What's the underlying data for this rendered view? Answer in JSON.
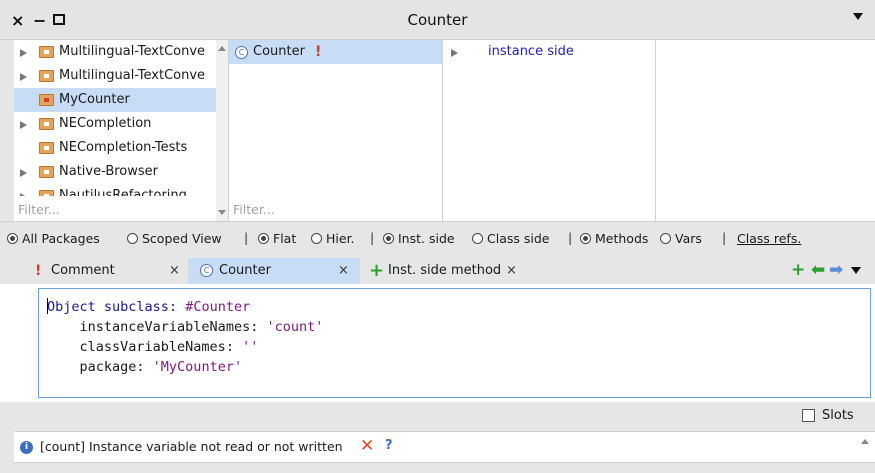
{
  "window": {
    "title": "Counter",
    "close_glyph": "×",
    "min_glyph": "−"
  },
  "packages": {
    "items": [
      {
        "label": "Multilingual-TextConve",
        "expandable": true,
        "selected": false
      },
      {
        "label": "Multilingual-TextConve",
        "expandable": true,
        "selected": false
      },
      {
        "label": "MyCounter",
        "expandable": false,
        "selected": true
      },
      {
        "label": "NECompletion",
        "expandable": true,
        "selected": false
      },
      {
        "label": "NECompletion-Tests",
        "expandable": false,
        "selected": false
      },
      {
        "label": "Native-Browser",
        "expandable": true,
        "selected": false
      },
      {
        "label": "NautilusRefactoring",
        "expandable": true,
        "selected": false
      }
    ],
    "filter_placeholder": "Filter..."
  },
  "classes": {
    "items": [
      {
        "label": "Counter",
        "icon": "class-icon",
        "circle_glyph": "C",
        "warning": "!",
        "selected": true
      }
    ],
    "filter_placeholder": "Filter..."
  },
  "protocols": {
    "items": [
      {
        "label": "instance side",
        "expandable": true
      }
    ]
  },
  "radios": {
    "all_packages": "All Packages",
    "scoped_view": "Scoped View",
    "flat": "Flat",
    "hier": "Hier.",
    "inst_side": "Inst. side",
    "class_side": "Class side",
    "methods": "Methods",
    "vars": "Vars",
    "class_refs": "Class refs.",
    "separator": "|"
  },
  "tabs": [
    {
      "label": "Comment",
      "icon": "warning-icon",
      "icon_glyph": "!",
      "close": "×",
      "active": false
    },
    {
      "label": "Counter",
      "icon": "class-icon",
      "icon_glyph": "C",
      "close": "×",
      "active": true
    },
    {
      "label": "Inst. side method",
      "icon": "plus-icon",
      "icon_glyph": "+",
      "close": "×",
      "active": false
    }
  ],
  "tools": {
    "add_glyph": "+",
    "back_glyph": "⬅",
    "forward_glyph": "➡"
  },
  "editor": {
    "line1_first": "O",
    "line1_rest": "bject subclass: ",
    "line1_symbol": "#Counter",
    "line2_key": "instanceVariableNames: ",
    "line2_value": "'count'",
    "line3_key": "classVariableNames: ",
    "line3_value": "''",
    "line4_key": "package: ",
    "line4_value": "'MyCounter'"
  },
  "slots": {
    "label": "Slots",
    "checked": false
  },
  "critic": {
    "info_glyph": "i",
    "message": "[count] Instance variable not read or not written",
    "ban_glyph": "✕",
    "help_glyph": "?"
  },
  "colors": {
    "selection": "#c8dcf5",
    "protocol_link": "#1f1fa8",
    "warning": "#d23a2a",
    "add_green": "#2e9e2e",
    "forward_blue": "#5a8ed8",
    "editor_border": "#6fa0d8"
  }
}
